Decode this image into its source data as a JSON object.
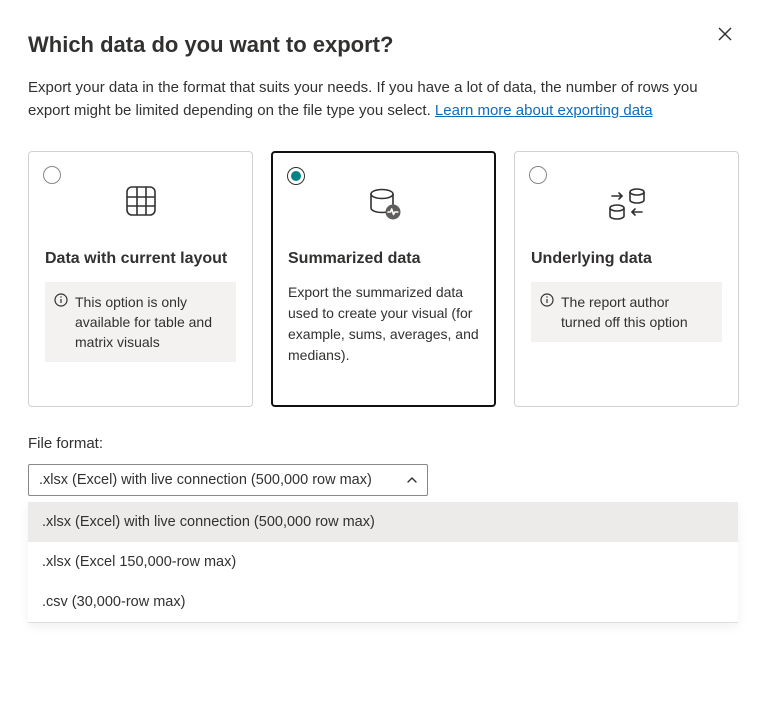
{
  "dialog": {
    "title": "Which data do you want to export?",
    "intro_text": "Export your data in the format that suits your needs. If you have a lot of data, the number of rows you export might be limited depending on the file type you select.  ",
    "learn_more": "Learn more about exporting data"
  },
  "cards": {
    "layout": {
      "title": "Data with current layout",
      "note": "This option is only available for table and matrix visuals"
    },
    "summarized": {
      "title": "Summarized data",
      "desc": "Export the summarized data used to create your visual (for example, sums, averages, and medians)."
    },
    "underlying": {
      "title": "Underlying data",
      "note": "The report author turned off this option"
    }
  },
  "format": {
    "label": "File format:",
    "selected": ".xlsx (Excel) with live connection (500,000 row max)",
    "options": [
      ".xlsx (Excel) with live connection (500,000 row max)",
      ".xlsx (Excel 150,000-row max)",
      ".csv (30,000-row max)"
    ]
  }
}
